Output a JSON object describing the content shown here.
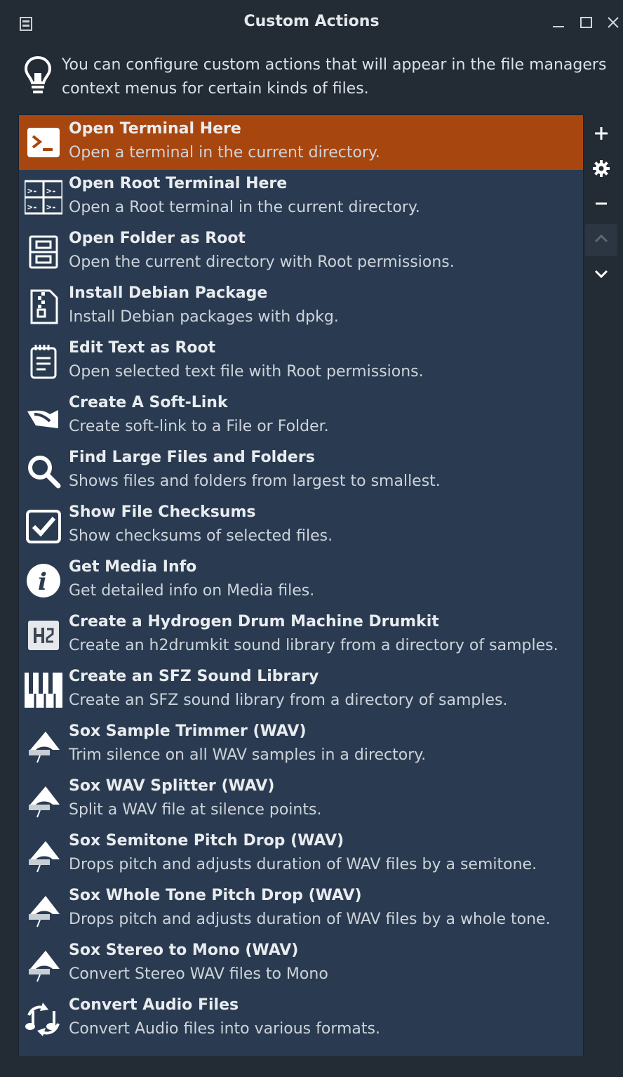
{
  "window": {
    "title": "Custom Actions",
    "minimize_icon": "minimize-icon",
    "maximize_icon": "maximize-icon",
    "close_icon": "close-icon",
    "accent": "#a8460f",
    "list_bg": "#2a3b51"
  },
  "info": {
    "icon": "lightbulb-icon",
    "text": "You can configure custom actions that will appear in the file managers context menus for certain kinds of files."
  },
  "actions": [
    {
      "name": "Open Terminal Here",
      "desc": "Open a terminal in the current directory.",
      "icon": "terminal-icon",
      "selected": true
    },
    {
      "name": "Open Root Terminal Here",
      "desc": "Open a Root terminal in the current directory.",
      "icon": "root-terminal-icon"
    },
    {
      "name": "Open Folder as Root",
      "desc": "Open the current directory with Root permissions.",
      "icon": "file-cabinet-icon"
    },
    {
      "name": "Install Debian Package",
      "desc": "Install Debian packages with dpkg.",
      "icon": "package-archive-icon"
    },
    {
      "name": "Edit Text as Root",
      "desc": "Open selected text file with Root permissions.",
      "icon": "notepad-icon"
    },
    {
      "name": "Create A Soft-Link",
      "desc": "Create soft-link to a File or Folder.",
      "icon": "link-arrow-icon"
    },
    {
      "name": "Find Large Files and Folders",
      "desc": "Shows files and folders from largest to smallest.",
      "icon": "magnifier-icon"
    },
    {
      "name": "Show File Checksums",
      "desc": "Show checksums of selected files.",
      "icon": "checkbox-icon"
    },
    {
      "name": "Get Media Info",
      "desc": "Get detailed info on Media files.",
      "icon": "info-icon"
    },
    {
      "name": "Create a Hydrogen Drum Machine Drumkit",
      "desc": "Create an h2drumkit sound library from a directory of samples.",
      "icon": "hydrogen-icon"
    },
    {
      "name": "Create an SFZ Sound Library",
      "desc": "Create an SFZ sound library from a directory of samples.",
      "icon": "piano-keys-icon"
    },
    {
      "name": "Sox Sample Trimmer (WAV)",
      "desc": "Trim silence on all WAV samples in a directory.",
      "icon": "sox-icon"
    },
    {
      "name": "Sox WAV Splitter (WAV)",
      "desc": "Split a WAV file at silence points.",
      "icon": "sox-icon"
    },
    {
      "name": "Sox Semitone Pitch Drop (WAV)",
      "desc": "Drops pitch and adjusts duration of WAV files by a semitone.",
      "icon": "sox-icon"
    },
    {
      "name": "Sox Whole Tone Pitch Drop (WAV)",
      "desc": "Drops pitch and adjusts duration of WAV files by a whole tone.",
      "icon": "sox-icon"
    },
    {
      "name": "Sox Stereo to Mono (WAV)",
      "desc": "Convert Stereo WAV files to Mono",
      "icon": "sox-icon"
    },
    {
      "name": "Convert Audio Files",
      "desc": "Convert Audio files into various formats.",
      "icon": "audio-convert-icon"
    }
  ],
  "side_buttons": [
    {
      "icon": "plus-icon",
      "enabled": true
    },
    {
      "icon": "gear-icon",
      "enabled": true
    },
    {
      "icon": "minus-icon",
      "enabled": true
    },
    {
      "icon": "chevron-up-icon",
      "enabled": false
    },
    {
      "icon": "chevron-down-icon",
      "enabled": true
    }
  ]
}
